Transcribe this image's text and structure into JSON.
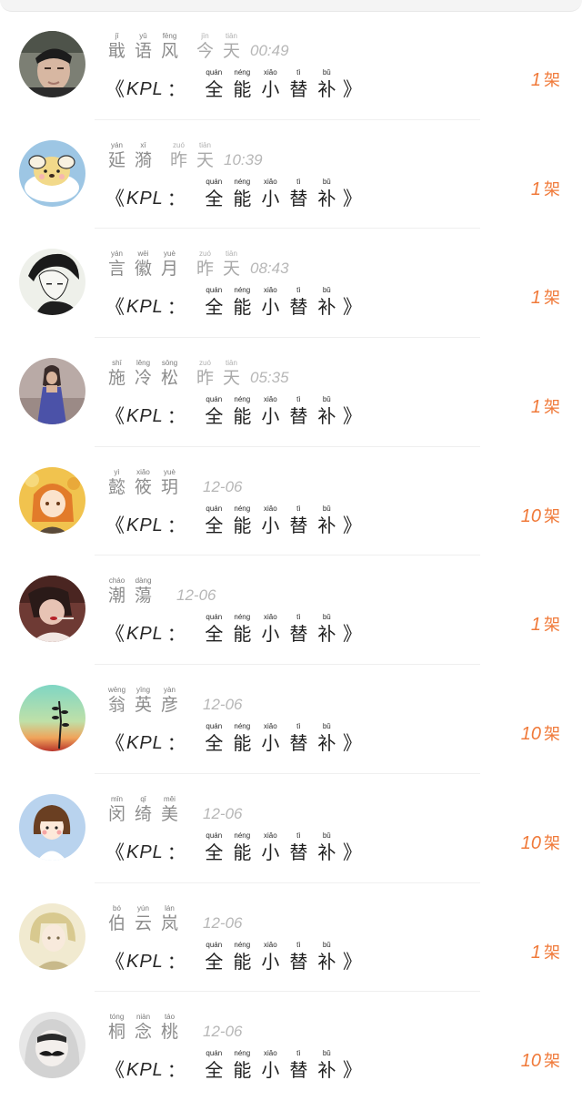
{
  "title": {
    "open": "《",
    "kpl": "KPL",
    "colon": "：",
    "close": "》",
    "chars": [
      {
        "py": "quán",
        "hz": "全"
      },
      {
        "py": "néng",
        "hz": "能"
      },
      {
        "py": "xiǎo",
        "hz": "小"
      },
      {
        "py": "tì",
        "hz": "替"
      },
      {
        "py": "bǔ",
        "hz": "补"
      }
    ]
  },
  "unit": "架",
  "colors": {
    "accent": "#f07a3a",
    "name": "#8c8c8c",
    "time": "#b7b7b7",
    "title": "#1f1f1f"
  },
  "rows": [
    {
      "name": [
        {
          "py": "jǐ",
          "hz": "戢"
        },
        {
          "py": "yǔ",
          "hz": "语"
        },
        {
          "py": "fēng",
          "hz": "风"
        }
      ],
      "day": [
        {
          "py": "jīn",
          "hz": "今"
        },
        {
          "py": "tiān",
          "hz": "天"
        }
      ],
      "time": "00:49",
      "count": "1",
      "avatar": "photo-young-man-avatar"
    },
    {
      "name": [
        {
          "py": "yán",
          "hz": "延"
        },
        {
          "py": "xī",
          "hz": "漪"
        }
      ],
      "day": [
        {
          "py": "zuó",
          "hz": "昨"
        },
        {
          "py": "tiān",
          "hz": "天"
        }
      ],
      "time": "10:39",
      "count": "1",
      "avatar": "cartoon-dog-avatar"
    },
    {
      "name": [
        {
          "py": "yán",
          "hz": "言"
        },
        {
          "py": "wēi",
          "hz": "徽"
        },
        {
          "py": "yuè",
          "hz": "月"
        }
      ],
      "day": [
        {
          "py": "zuó",
          "hz": "昨"
        },
        {
          "py": "tiān",
          "hz": "天"
        }
      ],
      "time": "08:43",
      "count": "1",
      "avatar": "anime-boy-sketch-avatar"
    },
    {
      "name": [
        {
          "py": "shī",
          "hz": "施"
        },
        {
          "py": "lěng",
          "hz": "冷"
        },
        {
          "py": "sōng",
          "hz": "松"
        }
      ],
      "day": [
        {
          "py": "zuó",
          "hz": "昨"
        },
        {
          "py": "tiān",
          "hz": "天"
        }
      ],
      "time": "05:35",
      "count": "1",
      "avatar": "girl-blue-dress-avatar"
    },
    {
      "name": [
        {
          "py": "yì",
          "hz": "懿"
        },
        {
          "py": "xiǎo",
          "hz": "筱"
        },
        {
          "py": "yuè",
          "hz": "玥"
        }
      ],
      "day": [],
      "time": "12-06",
      "count": "10",
      "avatar": "anime-girl-orange-avatar"
    },
    {
      "name": [
        {
          "py": "cháo",
          "hz": "潮"
        },
        {
          "py": "dàng",
          "hz": "蕩"
        }
      ],
      "day": [],
      "time": "12-06",
      "count": "1",
      "avatar": "woman-red-lips-avatar"
    },
    {
      "name": [
        {
          "py": "wēng",
          "hz": "翁"
        },
        {
          "py": "yīng",
          "hz": "英"
        },
        {
          "py": "yàn",
          "hz": "彦"
        }
      ],
      "day": [],
      "time": "12-06",
      "count": "10",
      "avatar": "sunset-plant-avatar"
    },
    {
      "name": [
        {
          "py": "mǐn",
          "hz": "闵"
        },
        {
          "py": "qǐ",
          "hz": "绮"
        },
        {
          "py": "měi",
          "hz": "美"
        }
      ],
      "day": [],
      "time": "12-06",
      "count": "10",
      "avatar": "cartoon-girl-bob-avatar"
    },
    {
      "name": [
        {
          "py": "bó",
          "hz": "伯"
        },
        {
          "py": "yún",
          "hz": "云"
        },
        {
          "py": "lán",
          "hz": "岚"
        }
      ],
      "day": [],
      "time": "12-06",
      "count": "1",
      "avatar": "anime-soft-portrait-avatar"
    },
    {
      "name": [
        {
          "py": "tóng",
          "hz": "桐"
        },
        {
          "py": "niàn",
          "hz": "念"
        },
        {
          "py": "táo",
          "hz": "桃"
        }
      ],
      "day": [],
      "time": "12-06",
      "count": "10",
      "avatar": "mustache-hoodie-avatar"
    }
  ]
}
